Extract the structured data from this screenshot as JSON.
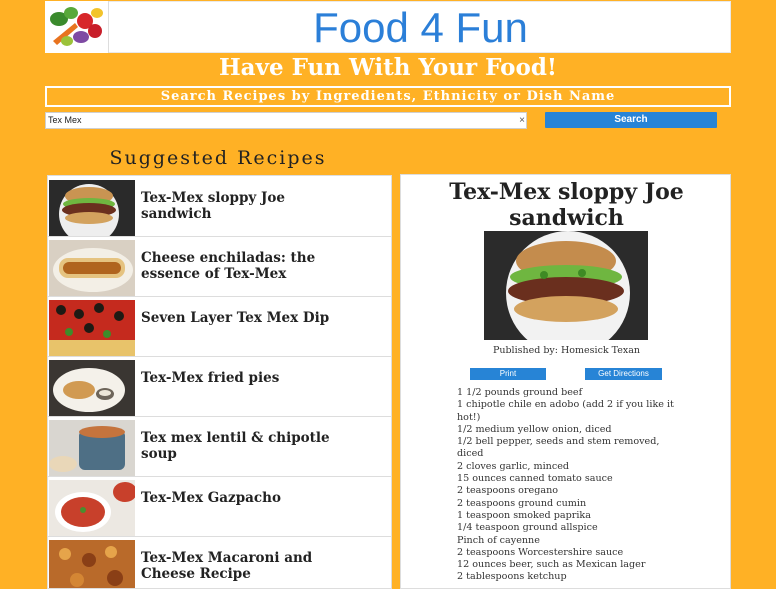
{
  "site": {
    "title": "Food 4 Fun",
    "tagline": "Have Fun With Your Food!",
    "search_banner": "Search Recipes by Ingredients, Ethnicity or Dish Name",
    "logo_icon": "vegetables-logo-icon"
  },
  "search": {
    "value": "Tex Mex",
    "clear_label": "×",
    "button_label": "Search"
  },
  "suggested": {
    "heading": "Suggested Recipes",
    "items": [
      {
        "title": "Tex-Mex sloppy Joe sandwich",
        "icon": "sloppy-joe-photo"
      },
      {
        "title": "Cheese enchiladas: the essence of Tex-Mex",
        "icon": "enchiladas-photo"
      },
      {
        "title": "Seven Layer Tex Mex Dip",
        "icon": "layer-dip-photo"
      },
      {
        "title": "Tex-Mex fried pies",
        "icon": "fried-pies-photo"
      },
      {
        "title": "Tex mex lentil & chipotle soup",
        "icon": "lentil-soup-photo"
      },
      {
        "title": "Tex-Mex Gazpacho",
        "icon": "gazpacho-photo"
      },
      {
        "title": "Tex-Mex Macaroni and Cheese Recipe",
        "icon": "macaroni-photo"
      }
    ]
  },
  "detail": {
    "title": "Tex-Mex sloppy Joe sandwich",
    "publisher": "Published by: Homesick Texan",
    "print_label": "Print",
    "directions_label": "Get Directions",
    "ingredients": [
      "1 1/2 pounds ground beef",
      "1 chipotle chile en adobo (add 2 if you like it hot!)",
      "1/2 medium yellow onion, diced",
      "1/2 bell pepper, seeds and stem removed, diced",
      "2 cloves garlic, minced",
      "15 ounces canned tomato sauce",
      "2 teaspoons oregano",
      "2 teaspoons ground cumin",
      "1 teaspoon smoked paprika",
      "1/4 teaspoon ground allspice",
      "Pinch of cayenne",
      "2 teaspoons Worcestershire sauce",
      "12 ounces beer, such as Mexican lager",
      "2 tablespoons ketchup"
    ]
  },
  "colors": {
    "background": "#ffb125",
    "title_blue": "#2b7fd8",
    "button_blue": "#2784d6"
  }
}
